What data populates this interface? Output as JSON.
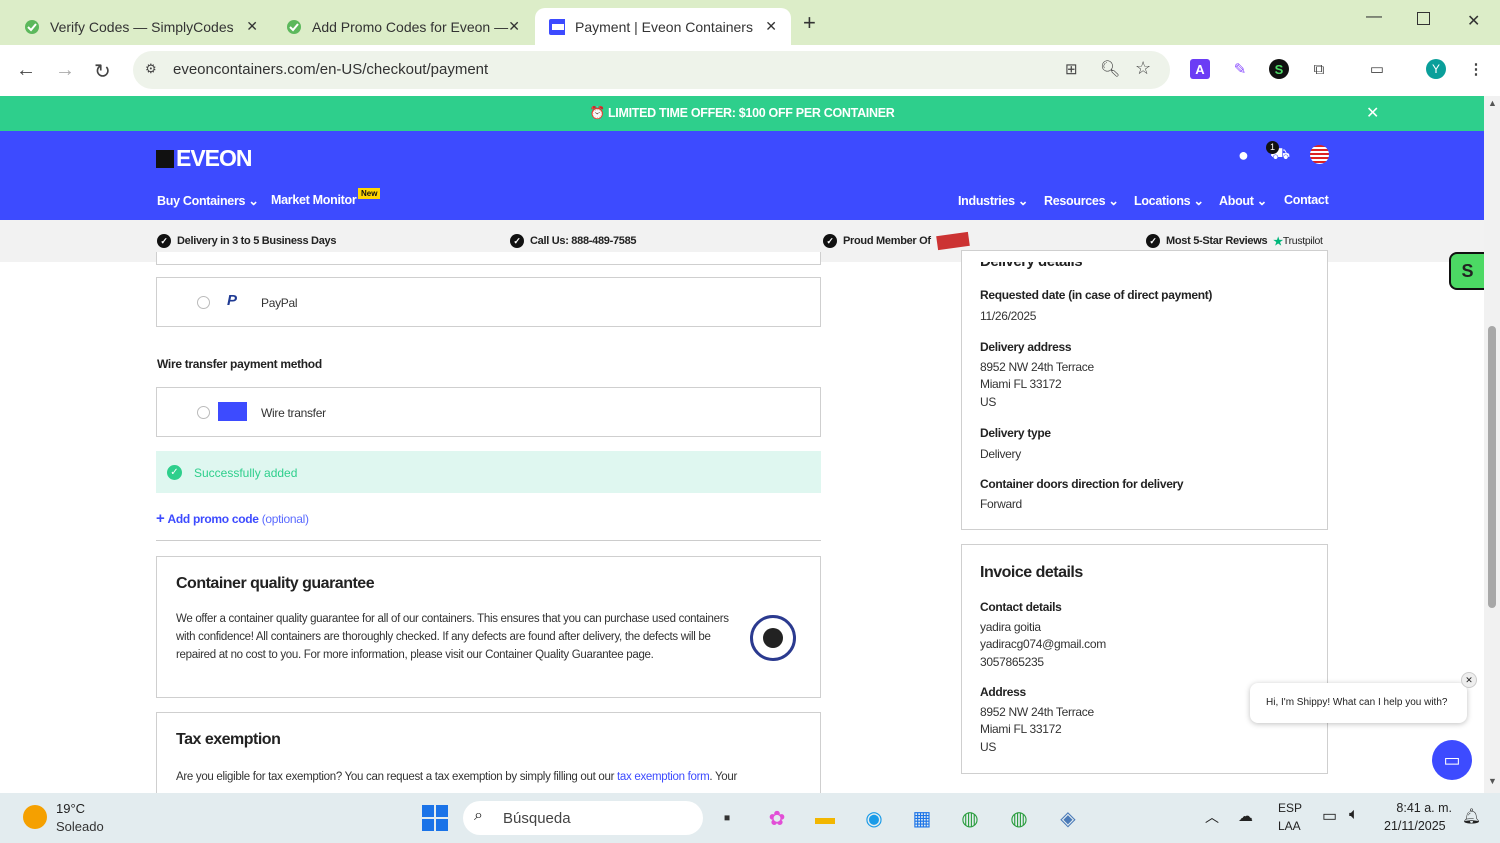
{
  "browser": {
    "tabs": [
      {
        "title": "Verify Codes — SimplyCodes",
        "active": false
      },
      {
        "title": "Add Promo Codes for Eveon —",
        "active": false
      },
      {
        "title": "Payment | Eveon Containers",
        "active": true
      }
    ],
    "new_tab": "+",
    "url": "eveoncontainers.com/en-US/checkout/payment",
    "profile_initial": "Y"
  },
  "site": {
    "promo_banner": "⏰ LIMITED TIME OFFER: $100 OFF PER CONTAINER",
    "logo": "EVEON",
    "cart_count": "1",
    "nav_left": [
      "Buy Containers",
      "Market Monitor"
    ],
    "new_badge": "New",
    "nav_right": [
      "Industries",
      "Resources",
      "Locations",
      "About",
      "Contact"
    ],
    "usp": [
      "Delivery in 3 to 5 Business Days",
      "Call Us: 888-489-7585",
      "Proud Member Of",
      "Most 5-Star Reviews"
    ],
    "trustpilot": "Trustpilot",
    "paypal_label": "PayPal",
    "wire_heading": "Wire transfer payment method",
    "wire_label": "Wire transfer",
    "success_msg": "Successfully added",
    "promo_code_link": "Add promo code",
    "promo_optional": "(optional)",
    "guarantee": {
      "title": "Container quality guarantee",
      "text": "We offer a container quality guarantee for all of our containers. This ensures that you can purchase used containers with confidence! All containers are thoroughly checked. If any defects are found after delivery, the defects will be repaired at no cost to you. For more information, please visit our Container Quality Guarantee page."
    },
    "tax": {
      "title": "Tax exemption",
      "text_before": "Are you eligible for tax exemption? You can request a tax exemption by simply filling out our ",
      "link": "tax exemption form",
      "text_after": ". Your"
    },
    "delivery": {
      "heading": "Delivery details",
      "requested_date_label": "Requested date (in case of direct payment)",
      "requested_date": "11/26/2025",
      "address_label": "Delivery address",
      "address": [
        "8952 NW 24th Terrace",
        "Miami FL 33172",
        "US"
      ],
      "type_label": "Delivery type",
      "type": "Delivery",
      "doors_label": "Container doors direction for delivery",
      "doors": "Forward"
    },
    "invoice": {
      "heading": "Invoice details",
      "contact_label": "Contact details",
      "contact": [
        "yadira goitia",
        "yadiracg074@gmail.com",
        "3057865235"
      ],
      "address_label": "Address",
      "address": [
        "8952 NW 24th Terrace",
        "Miami FL 33172",
        "US"
      ]
    },
    "chat_bubble": "Hi, I'm Shippy! What can I help you with?"
  },
  "taskbar": {
    "weather_temp": "19°C",
    "weather_desc": "Soleado",
    "search_placeholder": "Búsqueda",
    "lang_1": "ESP",
    "lang_2": "LAA",
    "time": "8:41 a. m.",
    "date": "21/11/2025"
  },
  "colors": {
    "promo_bg": "#2ecf8c",
    "header_bg": "#3d4bff",
    "tab_bar": "#dcedc8",
    "success_bg": "#dff7f0",
    "link": "#3d4bff"
  }
}
